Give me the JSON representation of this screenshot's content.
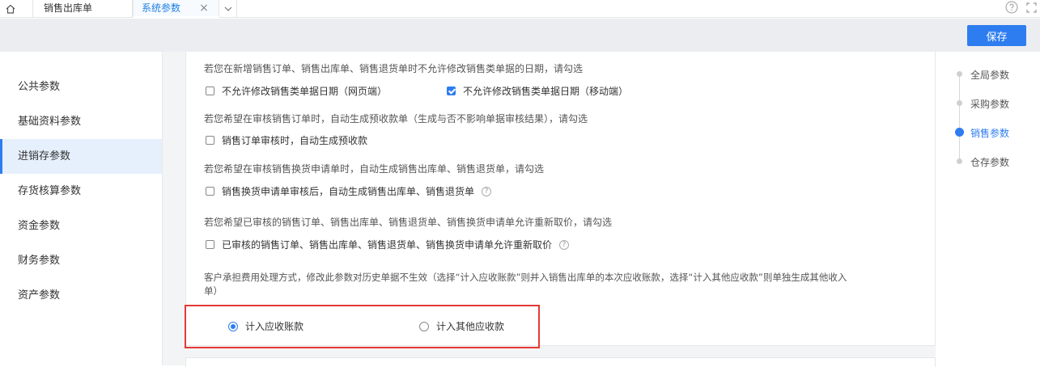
{
  "tabs": {
    "sales": "销售出库单",
    "system": "系统参数",
    "close_glyph": "×"
  },
  "toolbar": {
    "save_label": "保存"
  },
  "menu": {
    "items": [
      "公共参数",
      "基础资料参数",
      "进销存参数",
      "存货核算参数",
      "资金参数",
      "财务参数",
      "资产参数"
    ],
    "active_index": 2
  },
  "sections": {
    "date": {
      "desc": "若您在新增销售订单、销售出库单、销售退货单时不允许修改销售类单据的日期，请勾选",
      "opt1": "不允许修改销售类单据日期（网页端）",
      "opt2": "不允许修改销售类单据日期（移动端）"
    },
    "prepay": {
      "desc": "若您希望在审核销售订单时，自动生成预收款单（生成与否不影响单据审核结果），请勾选",
      "opt": "销售订单审核时，自动生成预收款"
    },
    "exchange": {
      "desc": "若您希望在审核销售换货申请单时，自动生成销售出库单、销售退货单，请勾选",
      "opt": "销售换货申请单审核后，自动生成销售出库单、销售退货单"
    },
    "reprice": {
      "desc": "若您希望已审核的销售订单、销售出库单、销售退货单、销售换货申请单允许重新取价，请勾选",
      "opt": "已审核的销售订单、销售出库单、销售退货单、销售换货申请单允许重新取价"
    },
    "fee": {
      "desc_line1": "客户承担费用处理方式，修改此参数对历史单据不生效（选择“计入应收账款”则并入销售出库单的本次应收账款，选择“计入其他应收款”则单独生成其他收入",
      "desc_line2": "单）",
      "radio1": "计入应收账款",
      "radio2": "计入其他应收款"
    }
  },
  "anchors": {
    "items": [
      "全局参数",
      "采购参数",
      "销售参数",
      "仓存参数"
    ],
    "active_index": 2
  },
  "help_glyph": "?",
  "colors": {
    "accent": "#2e7df0",
    "highlight_box": "#e53935"
  }
}
